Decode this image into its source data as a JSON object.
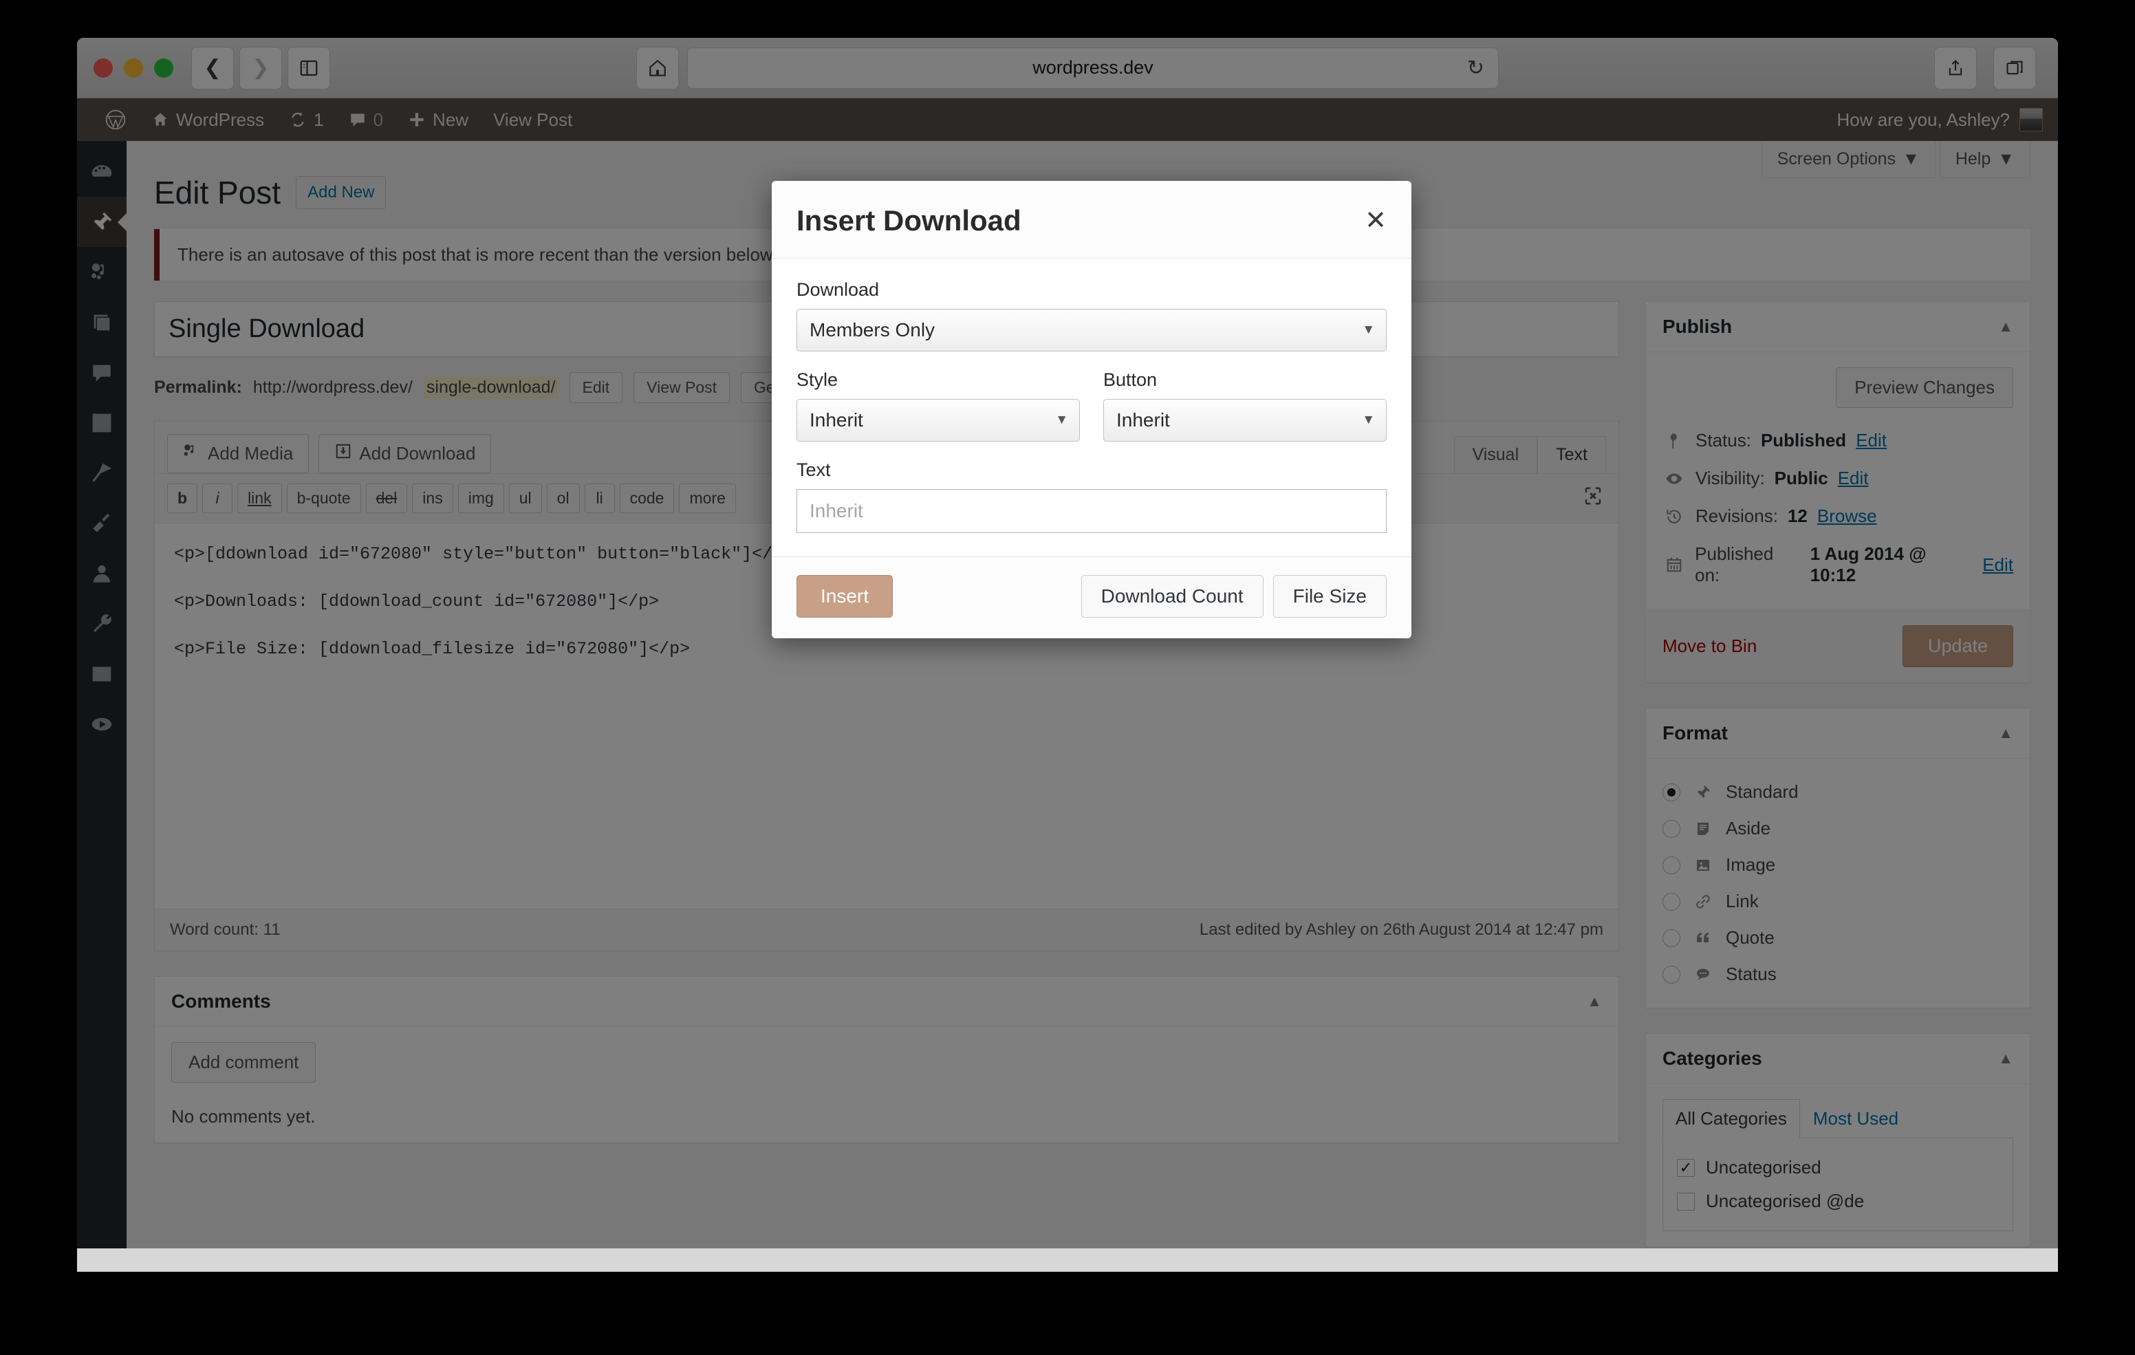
{
  "browser": {
    "url": "wordpress.dev",
    "back_icon": "chevron-left-icon",
    "forward_icon": "chevron-right-icon",
    "sidebar_icon": "sidebar-toggle-icon",
    "home_icon": "home-icon",
    "reload_icon": "reload-icon",
    "share_icon": "share-icon",
    "tabs_icon": "tabs-icon"
  },
  "adminbar": {
    "logo": "wordpress-logo-icon",
    "site_name": "WordPress",
    "updates_count": "1",
    "comments_count": "0",
    "new_label": "New",
    "view_post_label": "View Post",
    "greeting": "How are you, Ashley?"
  },
  "adminmenu": {
    "items": [
      {
        "name": "dashboard",
        "icon": "dashboard-icon"
      },
      {
        "name": "posts",
        "icon": "pin-icon",
        "active": true
      },
      {
        "name": "media",
        "icon": "media-icon"
      },
      {
        "name": "pages",
        "icon": "pages-icon"
      },
      {
        "name": "comments",
        "icon": "comment-icon"
      },
      {
        "name": "downloads",
        "icon": "download-icon"
      },
      {
        "name": "appearance",
        "icon": "brush-icon"
      },
      {
        "name": "plugins",
        "icon": "plugin-icon"
      },
      {
        "name": "users",
        "icon": "user-icon"
      },
      {
        "name": "tools",
        "icon": "wrench-icon"
      },
      {
        "name": "settings",
        "icon": "settings-icon"
      },
      {
        "name": "collapse",
        "icon": "play-icon"
      }
    ]
  },
  "screen_meta": {
    "screen_options": "Screen Options",
    "help": "Help",
    "caret": "▼"
  },
  "page": {
    "title": "Edit Post",
    "add_new": "Add New",
    "autosave_notice": "There is an autosave of this post that is more recent than the version below."
  },
  "post": {
    "title": "Single Download",
    "permalink_label": "Permalink:",
    "permalink_base": "http://wordpress.dev/",
    "permalink_slug": "single-download/",
    "perm_edit": "Edit",
    "perm_view": "View Post",
    "perm_get": "Get Shortlink"
  },
  "editor": {
    "add_media": "Add Media",
    "add_media_icon": "media-icon",
    "add_download": "Add Download",
    "add_download_icon": "download-icon",
    "tab_visual": "Visual",
    "tab_text": "Text",
    "fullscreen_icon": "fullscreen-icon",
    "quicktags": [
      "b",
      "i",
      "link",
      "b-quote",
      "del",
      "ins",
      "img",
      "ul",
      "ol",
      "li",
      "code",
      "more"
    ],
    "content_lines": [
      "<p>[ddownload id=\"672080\" style=\"button\" button=\"black\"]</p>",
      "<p>Downloads: [ddownload_count id=\"672080\"]</p>",
      "<p>File Size: [ddownload_filesize id=\"672080\"]</p>"
    ],
    "word_count": "Word count: 11",
    "last_edited": "Last edited by Ashley on 26th August 2014 at 12:47 pm"
  },
  "publish": {
    "heading": "Publish",
    "preview_changes": "Preview Changes",
    "status_label": "Status:",
    "status_value": "Published",
    "status_edit": "Edit",
    "status_icon": "pin-marker-icon",
    "visibility_label": "Visibility:",
    "visibility_value": "Public",
    "visibility_edit": "Edit",
    "visibility_icon": "eye-icon",
    "revisions_label": "Revisions:",
    "revisions_value": "12",
    "revisions_browse": "Browse",
    "revisions_icon": "clock-icon",
    "published_label": "Published on:",
    "published_value": "1 Aug 2014 @ 10:12",
    "published_edit": "Edit",
    "published_icon": "calendar-icon",
    "move_to_bin": "Move to Bin",
    "update": "Update"
  },
  "format": {
    "heading": "Format",
    "options": [
      {
        "label": "Standard",
        "icon": "pin-icon",
        "selected": true
      },
      {
        "label": "Aside",
        "icon": "aside-icon",
        "selected": false
      },
      {
        "label": "Image",
        "icon": "image-icon",
        "selected": false
      },
      {
        "label": "Link",
        "icon": "link-icon",
        "selected": false
      },
      {
        "label": "Quote",
        "icon": "quote-icon",
        "selected": false
      },
      {
        "label": "Status",
        "icon": "status-icon",
        "selected": false
      }
    ]
  },
  "categories": {
    "heading": "Categories",
    "tab_all": "All Categories",
    "tab_most_used": "Most Used",
    "items": [
      {
        "label": "Uncategorised",
        "checked": true
      },
      {
        "label": "Uncategorised @de",
        "checked": false
      }
    ]
  },
  "comments": {
    "heading": "Comments",
    "add_comment": "Add comment",
    "empty": "No comments yet."
  },
  "modal": {
    "title": "Insert Download",
    "close_icon": "close-icon",
    "download_label": "Download",
    "download_value": "Members Only",
    "style_label": "Style",
    "style_value": "Inherit",
    "button_label": "Button",
    "button_value": "Inherit",
    "text_label": "Text",
    "text_value": "",
    "text_placeholder": "Inherit",
    "insert": "Insert",
    "download_count": "Download Count",
    "file_size": "File Size",
    "caret": "▼",
    "accent_color": "#c8a087"
  }
}
